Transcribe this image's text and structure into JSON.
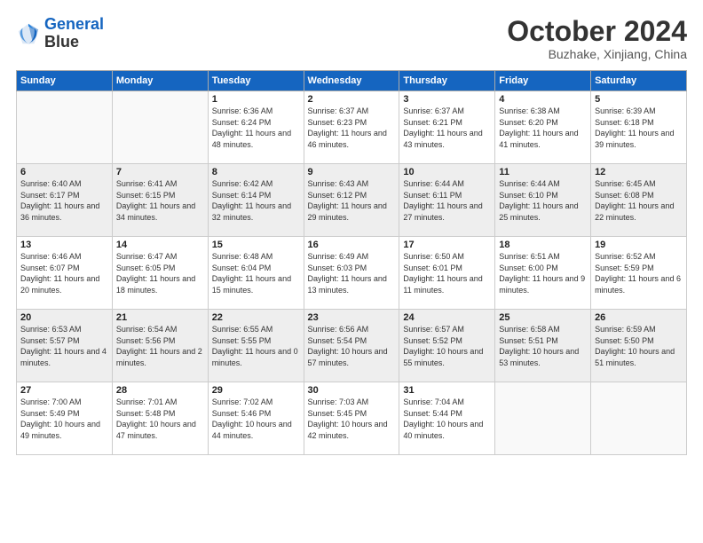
{
  "header": {
    "logo_line1": "General",
    "logo_line2": "Blue",
    "month": "October 2024",
    "location": "Buzhake, Xinjiang, China"
  },
  "weekdays": [
    "Sunday",
    "Monday",
    "Tuesday",
    "Wednesday",
    "Thursday",
    "Friday",
    "Saturday"
  ],
  "weeks": [
    [
      {
        "day": "",
        "info": ""
      },
      {
        "day": "",
        "info": ""
      },
      {
        "day": "1",
        "info": "Sunrise: 6:36 AM\nSunset: 6:24 PM\nDaylight: 11 hours and 48 minutes."
      },
      {
        "day": "2",
        "info": "Sunrise: 6:37 AM\nSunset: 6:23 PM\nDaylight: 11 hours and 46 minutes."
      },
      {
        "day": "3",
        "info": "Sunrise: 6:37 AM\nSunset: 6:21 PM\nDaylight: 11 hours and 43 minutes."
      },
      {
        "day": "4",
        "info": "Sunrise: 6:38 AM\nSunset: 6:20 PM\nDaylight: 11 hours and 41 minutes."
      },
      {
        "day": "5",
        "info": "Sunrise: 6:39 AM\nSunset: 6:18 PM\nDaylight: 11 hours and 39 minutes."
      }
    ],
    [
      {
        "day": "6",
        "info": "Sunrise: 6:40 AM\nSunset: 6:17 PM\nDaylight: 11 hours and 36 minutes."
      },
      {
        "day": "7",
        "info": "Sunrise: 6:41 AM\nSunset: 6:15 PM\nDaylight: 11 hours and 34 minutes."
      },
      {
        "day": "8",
        "info": "Sunrise: 6:42 AM\nSunset: 6:14 PM\nDaylight: 11 hours and 32 minutes."
      },
      {
        "day": "9",
        "info": "Sunrise: 6:43 AM\nSunset: 6:12 PM\nDaylight: 11 hours and 29 minutes."
      },
      {
        "day": "10",
        "info": "Sunrise: 6:44 AM\nSunset: 6:11 PM\nDaylight: 11 hours and 27 minutes."
      },
      {
        "day": "11",
        "info": "Sunrise: 6:44 AM\nSunset: 6:10 PM\nDaylight: 11 hours and 25 minutes."
      },
      {
        "day": "12",
        "info": "Sunrise: 6:45 AM\nSunset: 6:08 PM\nDaylight: 11 hours and 22 minutes."
      }
    ],
    [
      {
        "day": "13",
        "info": "Sunrise: 6:46 AM\nSunset: 6:07 PM\nDaylight: 11 hours and 20 minutes."
      },
      {
        "day": "14",
        "info": "Sunrise: 6:47 AM\nSunset: 6:05 PM\nDaylight: 11 hours and 18 minutes."
      },
      {
        "day": "15",
        "info": "Sunrise: 6:48 AM\nSunset: 6:04 PM\nDaylight: 11 hours and 15 minutes."
      },
      {
        "day": "16",
        "info": "Sunrise: 6:49 AM\nSunset: 6:03 PM\nDaylight: 11 hours and 13 minutes."
      },
      {
        "day": "17",
        "info": "Sunrise: 6:50 AM\nSunset: 6:01 PM\nDaylight: 11 hours and 11 minutes."
      },
      {
        "day": "18",
        "info": "Sunrise: 6:51 AM\nSunset: 6:00 PM\nDaylight: 11 hours and 9 minutes."
      },
      {
        "day": "19",
        "info": "Sunrise: 6:52 AM\nSunset: 5:59 PM\nDaylight: 11 hours and 6 minutes."
      }
    ],
    [
      {
        "day": "20",
        "info": "Sunrise: 6:53 AM\nSunset: 5:57 PM\nDaylight: 11 hours and 4 minutes."
      },
      {
        "day": "21",
        "info": "Sunrise: 6:54 AM\nSunset: 5:56 PM\nDaylight: 11 hours and 2 minutes."
      },
      {
        "day": "22",
        "info": "Sunrise: 6:55 AM\nSunset: 5:55 PM\nDaylight: 11 hours and 0 minutes."
      },
      {
        "day": "23",
        "info": "Sunrise: 6:56 AM\nSunset: 5:54 PM\nDaylight: 10 hours and 57 minutes."
      },
      {
        "day": "24",
        "info": "Sunrise: 6:57 AM\nSunset: 5:52 PM\nDaylight: 10 hours and 55 minutes."
      },
      {
        "day": "25",
        "info": "Sunrise: 6:58 AM\nSunset: 5:51 PM\nDaylight: 10 hours and 53 minutes."
      },
      {
        "day": "26",
        "info": "Sunrise: 6:59 AM\nSunset: 5:50 PM\nDaylight: 10 hours and 51 minutes."
      }
    ],
    [
      {
        "day": "27",
        "info": "Sunrise: 7:00 AM\nSunset: 5:49 PM\nDaylight: 10 hours and 49 minutes."
      },
      {
        "day": "28",
        "info": "Sunrise: 7:01 AM\nSunset: 5:48 PM\nDaylight: 10 hours and 47 minutes."
      },
      {
        "day": "29",
        "info": "Sunrise: 7:02 AM\nSunset: 5:46 PM\nDaylight: 10 hours and 44 minutes."
      },
      {
        "day": "30",
        "info": "Sunrise: 7:03 AM\nSunset: 5:45 PM\nDaylight: 10 hours and 42 minutes."
      },
      {
        "day": "31",
        "info": "Sunrise: 7:04 AM\nSunset: 5:44 PM\nDaylight: 10 hours and 40 minutes."
      },
      {
        "day": "",
        "info": ""
      },
      {
        "day": "",
        "info": ""
      }
    ]
  ]
}
